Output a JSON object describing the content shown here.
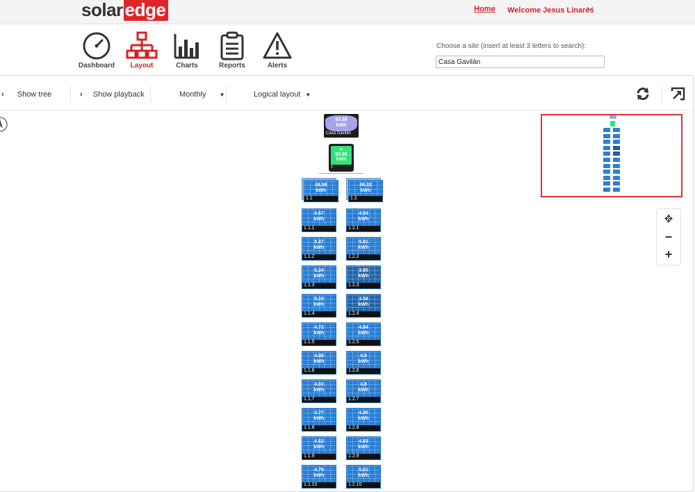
{
  "brand": {
    "part1": "solar",
    "part2": "edge"
  },
  "header": {
    "home": "Home",
    "welcome": "Welcome Jesus Linares"
  },
  "nav": [
    {
      "label": "Dashboard",
      "icon": "dashboard-icon"
    },
    {
      "label": "Layout",
      "icon": "layout-icon"
    },
    {
      "label": "Charts",
      "icon": "charts-icon"
    },
    {
      "label": "Reports",
      "icon": "reports-icon"
    },
    {
      "label": "Alerts",
      "icon": "alerts-icon"
    }
  ],
  "site": {
    "label": "Choose a site (insert at least 3 letters to search):",
    "value": "Casa Gavilán"
  },
  "toolbar": {
    "show_tree": "Show tree",
    "show_playback": "Show playback",
    "period": "Monthly",
    "layout_mode": "Logical layout"
  },
  "colors": {
    "accent": "#d72027",
    "module": "#2a7fd6",
    "module_dark": "#2566a8",
    "inverter": "#35e07a",
    "site": "#a6a4e6"
  },
  "site_node": {
    "value": "93.66",
    "unit": "kWh",
    "name": "Casa Gavilán"
  },
  "inverter": {
    "value": "93.66",
    "unit": "kWh",
    "id": "1"
  },
  "strings": [
    {
      "value": "48.98",
      "unit": "kWh",
      "id": "1.1"
    },
    {
      "value": "46.32",
      "unit": "kWh",
      "id": "1.2"
    }
  ],
  "modules": {
    "col1": [
      {
        "value": "4.67",
        "id": "1.1.1"
      },
      {
        "value": "5.27",
        "id": "1.1.2"
      },
      {
        "value": "5.24",
        "id": "1.1.3"
      },
      {
        "value": "5.19",
        "id": "1.1.4"
      },
      {
        "value": "4.72",
        "id": "1.1.5"
      },
      {
        "value": "4.89",
        "id": "1.1.6"
      },
      {
        "value": "4.83",
        "id": "1.1.7"
      },
      {
        "value": "4.77",
        "id": "1.1.8"
      },
      {
        "value": "4.62",
        "id": "1.1.9"
      },
      {
        "value": "4.79",
        "id": "1.1.10"
      }
    ],
    "col2": [
      {
        "value": "4.54",
        "id": "1.2.1"
      },
      {
        "value": "5.01",
        "id": "1.2.2"
      },
      {
        "value": "3.95",
        "id": "1.2.3"
      },
      {
        "value": "3.58",
        "id": "1.2.4"
      },
      {
        "value": "4.84",
        "id": "1.2.5"
      },
      {
        "value": "4.9",
        "id": "1.2.6"
      },
      {
        "value": "4.8",
        "id": "1.2.7"
      },
      {
        "value": "4.85",
        "id": "1.2.8"
      },
      {
        "value": "4.83",
        "id": "1.2.9"
      },
      {
        "value": "5.01",
        "id": "1.2.10"
      }
    ],
    "unit": "kWh"
  }
}
